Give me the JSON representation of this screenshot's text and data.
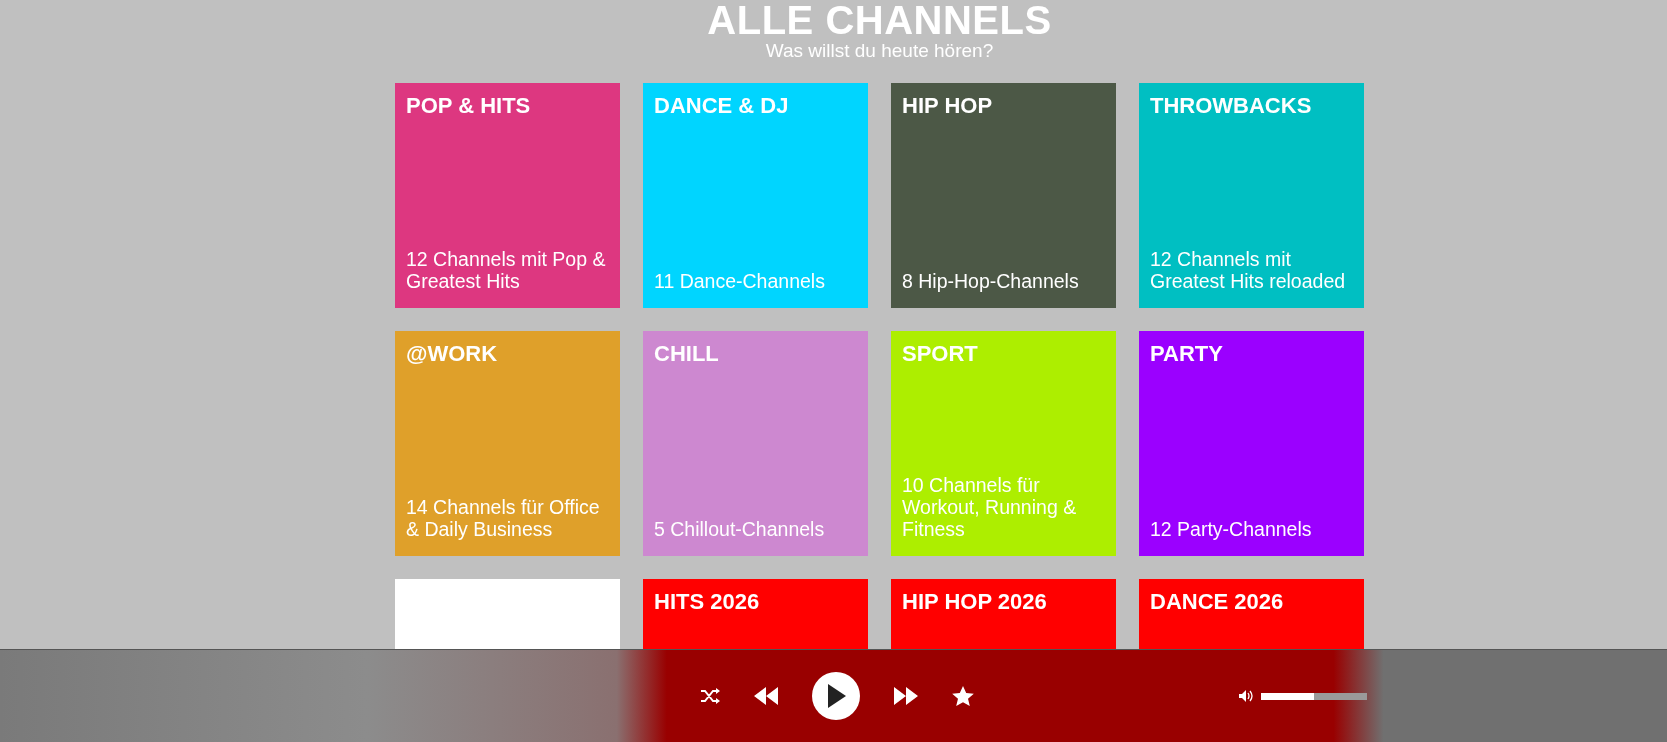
{
  "header": {
    "title": "ALLE CHANNELS",
    "subtitle": "Was willst du heute hören?"
  },
  "channels": [
    {
      "name": "POP & HITS",
      "description": "12 Channels mit Pop & Greatest Hits",
      "color": "#dd3780"
    },
    {
      "name": "DANCE & DJ",
      "description": "11 Dance-Channels",
      "color": "#00d5ff"
    },
    {
      "name": "HIP HOP",
      "description": "8 Hip-Hop-Channels",
      "color": "#4c5846"
    },
    {
      "name": "THROWBACKS",
      "description": "12 Channels mit Greatest Hits reloaded",
      "color": "#00bfc2"
    },
    {
      "name": "@WORK",
      "description": "14 Channels für Office & Daily Business",
      "color": "#dfa02a"
    },
    {
      "name": "CHILL",
      "description": "5 Chillout-Channels",
      "color": "#cd88d0"
    },
    {
      "name": "SPORT",
      "description": "10 Channels für Workout, Running & Fitness",
      "color": "#adee00"
    },
    {
      "name": "PARTY",
      "description": "12 Party-Channels",
      "color": "#9b00ff"
    },
    {
      "color": "#ffffff"
    },
    {
      "name": "HITS 2026",
      "color": "#ff0000"
    },
    {
      "name": "HIP HOP 2026",
      "color": "#ff0000"
    },
    {
      "name": "DANCE 2026",
      "color": "#ff0000"
    }
  ],
  "player": {
    "volume": {
      "level": 0.5
    }
  }
}
